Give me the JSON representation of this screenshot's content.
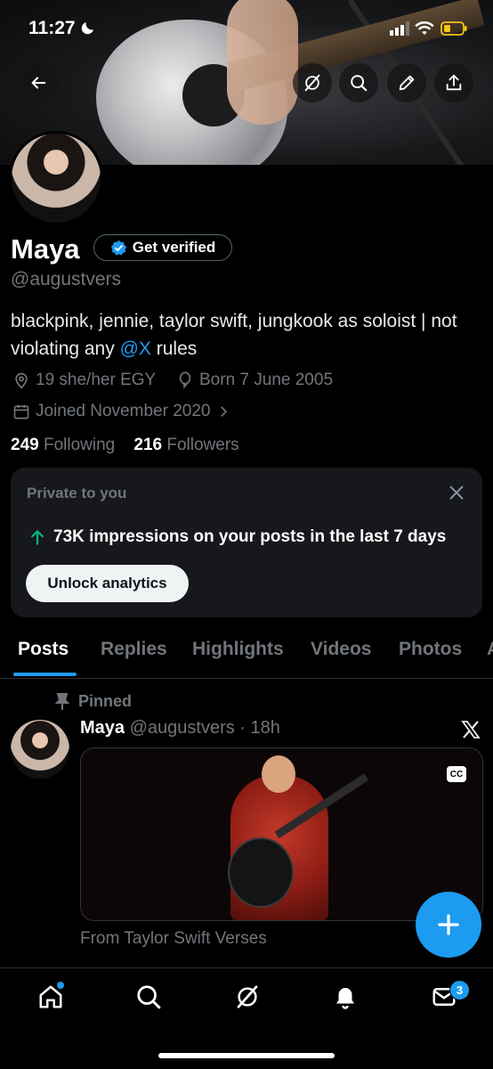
{
  "status_bar": {
    "time": "11:27",
    "battery_color": "#f5c518"
  },
  "header": {
    "back_icon": "arrow-left-icon",
    "grok_icon": "grok-icon",
    "search_icon": "search-icon",
    "edit_icon": "pencil-icon",
    "share_icon": "share-icon"
  },
  "profile": {
    "name": "Maya",
    "verify_label": "Get verified",
    "handle": "@augustvers",
    "bio_text": "blackpink, jennie, taylor swift, jungkook as soloist | not violating any ",
    "bio_link": "@X",
    "bio_tail": " rules",
    "location": "19 she/her EGY",
    "birthday": "Born 7 June 2005",
    "joined": "Joined November 2020",
    "following_count": "249",
    "following_label": "Following",
    "followers_count": "216",
    "followers_label": "Followers"
  },
  "analytics_card": {
    "title": "Private to you",
    "impressions_text": "73K impressions on your posts in the last 7 days",
    "unlock_label": "Unlock analytics"
  },
  "tabs": [
    "Posts",
    "Replies",
    "Highlights",
    "Videos",
    "Photos",
    "A"
  ],
  "post": {
    "pinned_label": "Pinned",
    "author": "Maya",
    "handle_time": "@augustvers · 18h",
    "cc_label": "CC",
    "source": "From Taylor Swift Verses"
  },
  "bottom_nav": {
    "items": [
      "home-icon",
      "search-icon",
      "grok-icon",
      "notifications-icon",
      "messages-icon"
    ],
    "messages_badge": "3"
  },
  "colors": {
    "accent": "#1d9bf0",
    "background": "#000000",
    "card": "#16181c",
    "up_arrow": "#00ba7c"
  }
}
